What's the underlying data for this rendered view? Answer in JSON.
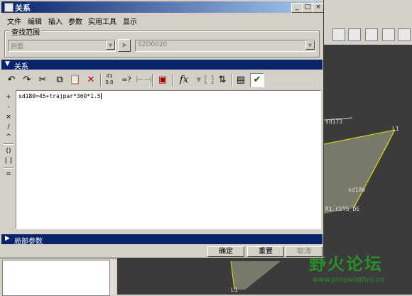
{
  "dialog": {
    "title": "关系",
    "window_controls": {
      "minimize": "_",
      "maximize": "□",
      "close": "×"
    }
  },
  "menu": [
    "文件",
    "编辑",
    "插入",
    "参数",
    "实用工具",
    "显示"
  ],
  "search_scope": {
    "label": "查找范围",
    "type_value": "剖面",
    "item_value": "S2D0020"
  },
  "relations_section": {
    "label": "关系"
  },
  "toolbar": {
    "icons": [
      "undo-icon",
      "redo-icon",
      "cut-icon",
      "copy-icon",
      "paste-icon",
      "delete-icon",
      "switch-symbols-icon",
      "evaluate-icon",
      "unit-sensitive-icon",
      "insert-parameter-icon",
      "function-icon",
      "brackets-icon",
      "sort-relations-icon",
      "execute-icon",
      "verify-icon"
    ],
    "switch_label_top": "d1",
    "switch_label_bottom": "0.0",
    "evaluate_label": "=?",
    "function_label": "fx"
  },
  "operators": [
    "+",
    "-",
    "×",
    "/",
    "^",
    "()",
    "[ ]",
    "="
  ],
  "editor": {
    "text": "sd180=45+trajpar*360*1.5"
  },
  "local_params": {
    "label": "局部参数"
  },
  "buttons": {
    "ok": "确定",
    "reset": "重置",
    "cancel": "取消"
  },
  "background": {
    "cad_labels": [
      "sd173",
      "L1",
      "sd180",
      "R1.CSYS_DE",
      "L1"
    ],
    "watermark": "野火论坛",
    "watermark_url": "www.proewildfire.cn"
  },
  "colors": {
    "titlebar": "#0a246a",
    "section_bar": "#0a246a",
    "chrome": "#d4d0c8",
    "cad_background": "#3b3b3b",
    "cad_shape": "#7a7a6a",
    "sketch_line": "#e6e600"
  }
}
